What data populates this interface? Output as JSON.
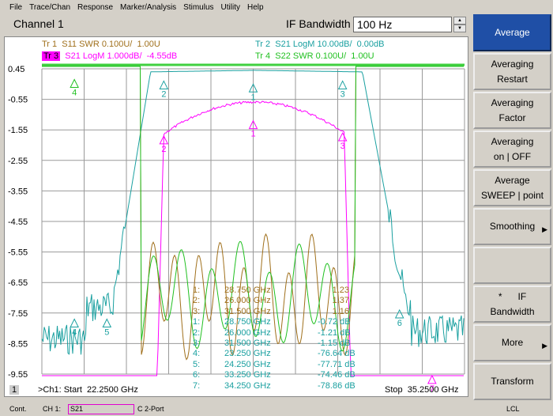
{
  "menu": [
    "File",
    "Trace/Chan",
    "Response",
    "Marker/Analysis",
    "Stimulus",
    "Utility",
    "Help"
  ],
  "channel": {
    "title": "Channel 1",
    "ifbw_label": "IF Bandwidth",
    "ifbw_value": "100 Hz"
  },
  "traces": {
    "tr1": {
      "id": "Tr 1",
      "desc": "S11 SWR 0.100U/  1.00U",
      "color": "#a0701c"
    },
    "tr2": {
      "id": "Tr 2",
      "desc": "S21 LogM 10.00dB/  0.00dB",
      "color": "#1aa0a0"
    },
    "tr3": {
      "id": "Tr 3",
      "desc": "S21 LogM 1.000dB/  -4.55dB",
      "color": "#ff00ff"
    },
    "tr4": {
      "id": "Tr 4",
      "desc": "S22 SWR 0.100U/  1.00U",
      "color": "#20c020"
    }
  },
  "yticks": [
    "0.45",
    "-0.55",
    "-1.55",
    "-2.55",
    "-3.55",
    "-4.55",
    "-5.55",
    "-6.55",
    "-7.55",
    "-8.55",
    "-9.55"
  ],
  "markers": {
    "tr1": [
      [
        "1:",
        "28.750 GHz",
        "1.23"
      ],
      [
        "2:",
        "26.000 GHz",
        "1.37"
      ],
      [
        "3:",
        "31.500 GHz",
        "1.16"
      ]
    ],
    "tr2": [
      [
        "1:",
        "28.750 GHz",
        "-0.72 dB"
      ],
      [
        "2:",
        "26.000 GHz",
        "-1.21 dB"
      ],
      [
        "3:",
        "31.500 GHz",
        "-1.15 dB"
      ],
      [
        "4:",
        "23.250 GHz",
        "-76.64 dB"
      ],
      [
        "5:",
        "24.250 GHz",
        "-77.71 dB"
      ],
      [
        "6:",
        "33.250 GHz",
        "-74.46 dB"
      ],
      [
        "7:",
        "34.250 GHz",
        "-78.86 dB"
      ]
    ],
    "tr3_partial": [
      "1:",
      "28.750 GHz",
      "-0.72 dB"
    ]
  },
  "stimulus": {
    "channel_num": "1",
    "start": ">Ch1: Start  22.2500 GHz",
    "stop": "Stop  35.2500 GHz"
  },
  "softkeys": [
    {
      "label": "Average",
      "active": true
    },
    {
      "label": "Averaging\nRestart"
    },
    {
      "label": "Averaging\nFactor"
    },
    {
      "label": "Averaging\non | OFF"
    },
    {
      "label": "Average\nSWEEP | point"
    },
    {
      "label": "Smoothing",
      "arrow": true
    },
    {
      "label": ""
    },
    {
      "label": "*      IF\nBandwidth"
    },
    {
      "label": "More",
      "arrow": true
    },
    {
      "label": "Transform"
    }
  ],
  "status": {
    "mode": "Cont.",
    "ch": "CH 1:",
    "meas": "S21",
    "cal": "C  2-Port",
    "remote": "LCL"
  }
}
